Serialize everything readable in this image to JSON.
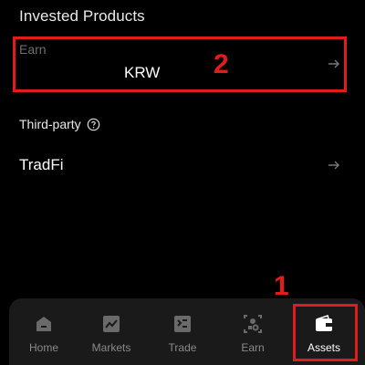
{
  "invested_products": {
    "title": "Invested Products"
  },
  "earn": {
    "label": "Earn",
    "currency": "KRW"
  },
  "third_party": {
    "label": "Third-party"
  },
  "tradfi": {
    "label": "TradFi"
  },
  "annotations": {
    "badge_1": "1",
    "badge_2": "2",
    "color": "#e21b1b"
  },
  "bottom_nav": {
    "items": [
      {
        "label": "Home",
        "icon": "home-icon"
      },
      {
        "label": "Markets",
        "icon": "chart-icon"
      },
      {
        "label": "Trade",
        "icon": "trade-icon"
      },
      {
        "label": "Earn",
        "icon": "earn-icon"
      },
      {
        "label": "Assets",
        "icon": "wallet-icon",
        "active": true
      }
    ]
  }
}
